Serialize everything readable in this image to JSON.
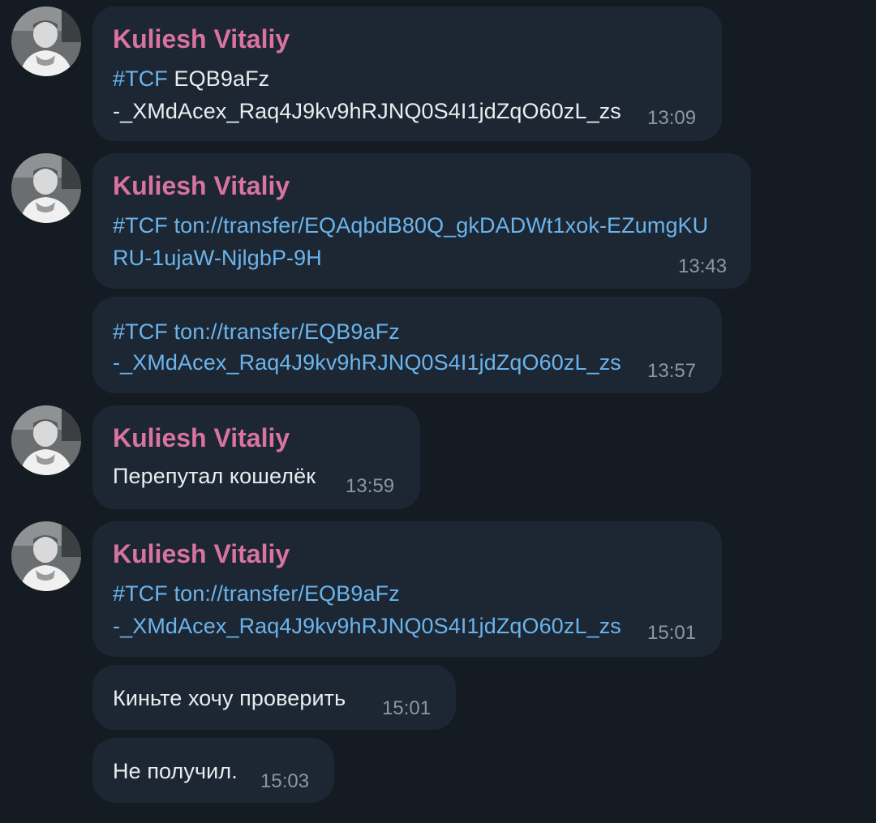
{
  "messages": [
    {
      "sender": "Kuliesh Vitaliy",
      "tag": "#TCF",
      "line1_rest": "EQB9aFz",
      "line2": "-_XMdAcex_Raq4J9kv9hRJNQ0S4I1jdZqO60zL_zs",
      "time": "13:09"
    },
    {
      "sender": "Kuliesh Vitaliy",
      "line1": "#TCF ton://transfer/EQAqbdB80Q_gkDADWt1xok-EZumgKU",
      "line2": "RU-1ujaW-NjlgbP-9H",
      "time": "13:43"
    },
    {
      "line1": "#TCF ton://transfer/EQB9aFz",
      "line2": "-_XMdAcex_Raq4J9kv9hRJNQ0S4I1jdZqO60zL_zs",
      "time": "13:57"
    },
    {
      "sender": "Kuliesh Vitaliy",
      "text": "Перепутал кошелёк",
      "time": "13:59"
    },
    {
      "sender": "Kuliesh Vitaliy",
      "line1": "#TCF ton://transfer/EQB9aFz",
      "line2": "-_XMdAcex_Raq4J9kv9hRJNQ0S4I1jdZqO60zL_zs",
      "time": "15:01"
    },
    {
      "text": "Киньте хочу проверить",
      "time": "15:01"
    },
    {
      "text": "Не получил.",
      "time": "15:03"
    }
  ],
  "colors": {
    "background": "#151b23",
    "bubble": "#1d2733",
    "sender": "#d9739f",
    "link": "#6ab4ec",
    "text": "#e9edf1",
    "time": "#8c97a3"
  }
}
